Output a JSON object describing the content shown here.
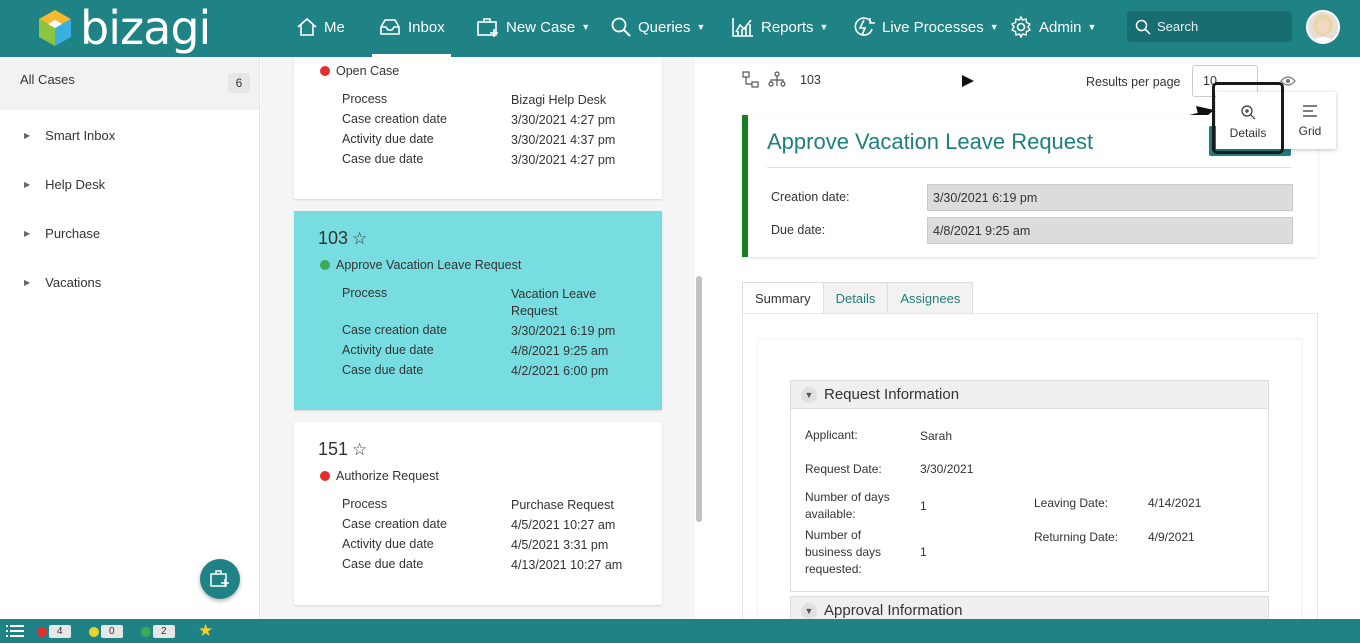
{
  "app": {
    "logo_text": "bizagi",
    "colors": {
      "primary": "#1f8285",
      "selected_card": "#78dde0",
      "title": "#1f7f7c",
      "accent_bar": "#1a7d24"
    }
  },
  "nav": {
    "me": "Me",
    "inbox": "Inbox",
    "new_case": "New Case",
    "queries": "Queries",
    "reports": "Reports",
    "live_processes": "Live Processes",
    "admin": "Admin",
    "search_placeholder": "Search"
  },
  "sidebar": {
    "all_cases_label": "All Cases",
    "all_cases_count": "6",
    "items": [
      {
        "label": "Smart Inbox"
      },
      {
        "label": "Help Desk"
      },
      {
        "label": "Purchase"
      },
      {
        "label": "Vacations"
      }
    ]
  },
  "cases": [
    {
      "task": "Open Case",
      "status_color": "red",
      "fields": [
        {
          "k": "Process",
          "v": "Bizagi Help Desk"
        },
        {
          "k": "Case creation date",
          "v": "3/30/2021 4:27 pm"
        },
        {
          "k": "Activity due date",
          "v": "3/30/2021 4:37 pm"
        },
        {
          "k": "Case due date",
          "v": "3/30/2021 4:27 pm"
        }
      ]
    },
    {
      "number": "103",
      "task": "Approve Vacation Leave Request",
      "status_color": "green",
      "fields": [
        {
          "k": "Process",
          "v": "Vacation Leave Request"
        },
        {
          "k": "Case creation date",
          "v": "3/30/2021 6:19 pm"
        },
        {
          "k": "Activity due date",
          "v": "4/8/2021 9:25 am"
        },
        {
          "k": "Case due date",
          "v": "4/2/2021 6:00 pm"
        }
      ]
    },
    {
      "number": "151",
      "task": "Authorize Request",
      "status_color": "red",
      "fields": [
        {
          "k": "Process",
          "v": "Purchase Request"
        },
        {
          "k": "Case creation date",
          "v": "4/5/2021 10:27 am"
        },
        {
          "k": "Activity due date",
          "v": "4/5/2021 3:31 pm"
        },
        {
          "k": "Case due date",
          "v": "4/13/2021 10:27 am"
        }
      ]
    }
  ],
  "detail": {
    "case_number": "103",
    "results_per_page_label": "Results per page",
    "results_per_page_value": "10",
    "view_details": "Details",
    "view_grid": "Grid",
    "title": "Approve Vacation Leave Request",
    "creation_date_label": "Creation date:",
    "creation_date_value": "3/30/2021 6:19 pm",
    "due_date_label": "Due date:",
    "due_date_value": "4/8/2021 9:25 am",
    "tabs": [
      "Summary",
      "Details",
      "Assignees"
    ],
    "request_group_title": "Request Information",
    "applicant_label": "Applicant:",
    "applicant_value": "Sarah",
    "request_date_label": "Request Date:",
    "request_date_value": "3/30/2021",
    "days_available_label": "Number of days available:",
    "days_available_value": "1",
    "leaving_date_label": "Leaving Date:",
    "leaving_date_value": "4/14/2021",
    "business_days_label": "Number of business days requested:",
    "business_days_value": "1",
    "returning_date_label": "Returning Date:",
    "returning_date_value": "4/9/2021",
    "approval_group_title": "Approval Information"
  },
  "bottom": {
    "red_count": "4",
    "yellow_count": "0",
    "green_count": "2"
  }
}
